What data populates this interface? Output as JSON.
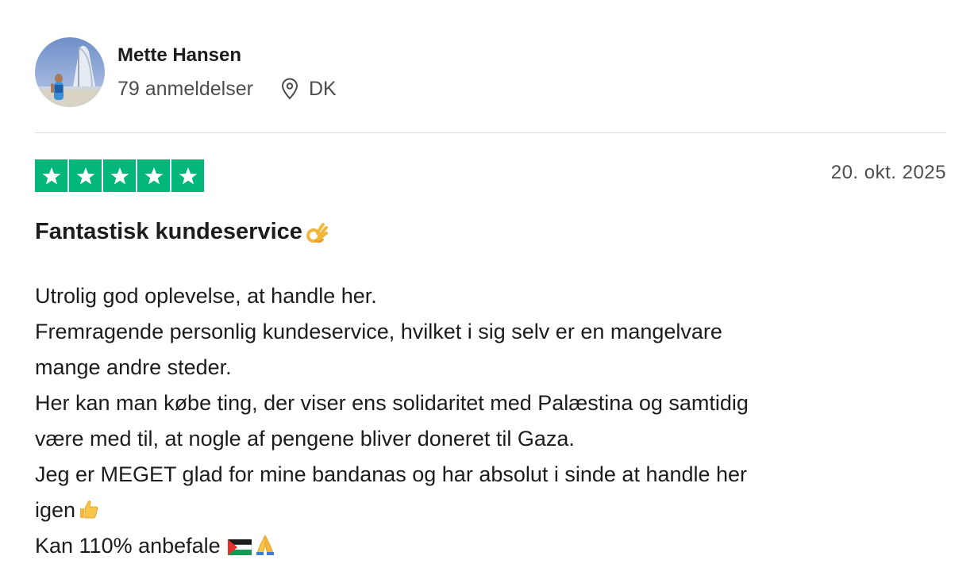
{
  "reviewer": {
    "name": "Mette Hansen",
    "reviews_count": "79 anmeldelser",
    "country": "DK",
    "avatar_icon": "profile-photo"
  },
  "review": {
    "rating": 5,
    "max_rating": 5,
    "date": "20. okt. 2025",
    "title": "Fantastisk kundeservice",
    "title_emoji": "ok-hand-icon",
    "body_lines": [
      "Utrolig god oplevelse, at handle her.",
      "Fremragende personlig kundeservice, hvilket i sig selv er en mangelvare",
      "mange andre steder.",
      "Her kan man købe ting, der viser ens solidaritet med Palæstina og samtidig",
      "være med til, at nogle af pengene bliver doneret til Gaza.",
      "Jeg er MEGET glad for mine bandanas og har absolut i sinde at handle her",
      "igen",
      "Kan 110% anbefale "
    ]
  },
  "colors": {
    "star_green": "#00b67a",
    "text": "#1c1c1c",
    "muted_text": "#4d4d4d",
    "divider": "#dcdce6"
  }
}
